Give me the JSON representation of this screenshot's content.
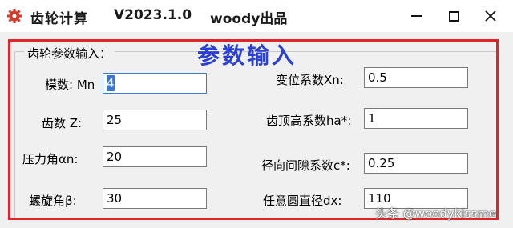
{
  "window": {
    "title": "齿轮计算",
    "version": "V2023.1.0",
    "author": "woody出品",
    "minimize": "—",
    "maximize": "□",
    "close": "✕"
  },
  "group": {
    "title": "齿轮参数输入：",
    "overlay_heading": "参数输入"
  },
  "fields_left": [
    {
      "label": "模数: Mn",
      "value": "4"
    },
    {
      "label": "齿数 Z:",
      "value": "25"
    },
    {
      "label": "压力角αn:",
      "value": "20"
    },
    {
      "label": "螺旋角β:",
      "value": "30"
    }
  ],
  "fields_right": [
    {
      "label": "变位系数Xn:",
      "value": "0.5"
    },
    {
      "label": "齿顶高系数ha*:",
      "value": "1"
    },
    {
      "label": "径向间隙系数c*:",
      "value": "0.25"
    },
    {
      "label": "任意圆直径dx:",
      "value": "110"
    }
  ],
  "watermark": "头条 @woodykissme",
  "colors": {
    "highlight_frame": "#e0242a",
    "overlay_heading": "#2a3fd4",
    "focus": "#3a77d8"
  },
  "icons": {
    "app": "gear-icon",
    "minimize": "minimize-icon",
    "maximize": "maximize-icon",
    "close": "close-icon"
  }
}
